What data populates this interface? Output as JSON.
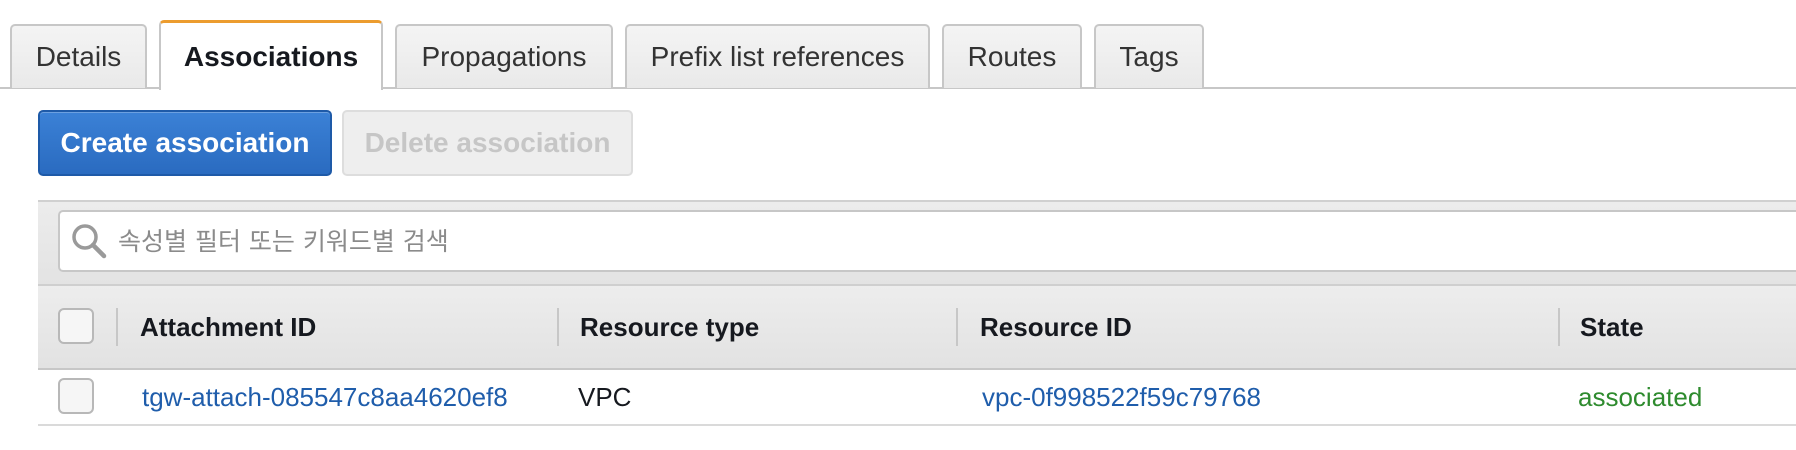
{
  "tabs": [
    {
      "label": "Details",
      "active": false
    },
    {
      "label": "Associations",
      "active": true
    },
    {
      "label": "Propagations",
      "active": false
    },
    {
      "label": "Prefix list references",
      "active": false
    },
    {
      "label": "Routes",
      "active": false
    },
    {
      "label": "Tags",
      "active": false
    }
  ],
  "toolbar": {
    "create_label": "Create association",
    "delete_label": "Delete association"
  },
  "search": {
    "placeholder": "속성별 필터 또는 키워드별 검색",
    "value": ""
  },
  "table": {
    "columns": [
      "Attachment ID",
      "Resource type",
      "Resource ID",
      "State"
    ],
    "rows": [
      {
        "attachment_id": "tgw-attach-085547c8aa4620ef8",
        "resource_type": "VPC",
        "resource_id": "vpc-0f998522f59c79768",
        "state": "associated"
      }
    ]
  },
  "colors": {
    "accent": "#ec9c2f",
    "primary": "#2a6bc0",
    "link": "#1f5dab",
    "state_ok": "#2e8b2e"
  },
  "icons": {
    "search": "search-icon"
  }
}
